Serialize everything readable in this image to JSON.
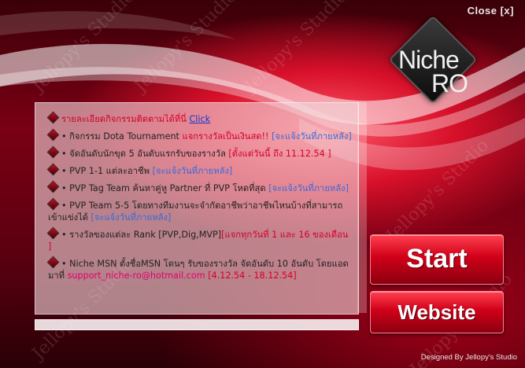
{
  "window": {
    "close_label": "Close [x]"
  },
  "logo": {
    "line1": "Niche",
    "line2": "RO"
  },
  "watermark": "Jellopy's Studio",
  "news": {
    "items": [
      {
        "parts": [
          {
            "text": "รายละเอียดกิจกรรมติดตามได้ที่นี่ ",
            "style": "red"
          },
          {
            "text": "Click",
            "style": "link"
          }
        ]
      },
      {
        "parts": [
          {
            "text": "• กิจกรรม Dota Tournament ",
            "style": "plain"
          },
          {
            "text": "แจกรางวัลเป็นเงินสด!! ",
            "style": "red"
          },
          {
            "text": "[จะแจ้งวันที่ภายหลัง]",
            "style": "blue"
          }
        ]
      },
      {
        "parts": [
          {
            "text": "• จัดอันดับนักขุด 5 อันดับแรกรับของรางวัล ",
            "style": "plain"
          },
          {
            "text": "[ตั้งแต่วันนี้ ถึง 11.12.54 ]",
            "style": "red"
          }
        ]
      },
      {
        "parts": [
          {
            "text": "• PVP 1-1 แต่ละอาชีพ ",
            "style": "plain"
          },
          {
            "text": "[จะแจ้งวันที่ภายหลัง]",
            "style": "blue"
          }
        ]
      },
      {
        "parts": [
          {
            "text": "• PVP Tag Team ค้นหาคู่หู Partner ที่ PVP โหดที่สุด ",
            "style": "plain"
          },
          {
            "text": "[จะแจ้งวันที่ภายหลัง]",
            "style": "blue"
          }
        ]
      },
      {
        "parts": [
          {
            "text": "• PVP Team 5-5 โดยทางทีมงานจะจำกัดอาชีพว่าอาชีพไหนบ้างที่สามารถเข้าแข่งได้ ",
            "style": "plain"
          },
          {
            "text": "[จะแจ้งวันที่ภายหลัง]",
            "style": "blue"
          }
        ]
      },
      {
        "parts": [
          {
            "text": "• รางวัลของแต่ละ Rank [PVP,Dig,MVP]",
            "style": "plain"
          },
          {
            "text": "[แจกทุกวันที่ 1 และ 16 ของเดือน ]",
            "style": "red"
          }
        ]
      },
      {
        "parts": [
          {
            "text": "• Niche MSN ตั้งชื่อMSN โดนๆ รับของรางวัล จัดอันดับ 10 อันดับ โดยแอดมาที่ ",
            "style": "plain"
          },
          {
            "text": "support_niche-ro@hotmail.com",
            "style": "pink"
          },
          {
            "text": " [4.12.54 - 18.12.54]",
            "style": "red"
          }
        ]
      }
    ]
  },
  "progress": {
    "value": 0
  },
  "buttons": {
    "start_label": "Start",
    "website_label": "Website"
  },
  "footer": {
    "credit": "Designed By Jellopy's Studio"
  },
  "colors": {
    "accent_red": "#d4002a",
    "link_blue": "#3a6ad8",
    "email_pink": "#e0006a"
  }
}
